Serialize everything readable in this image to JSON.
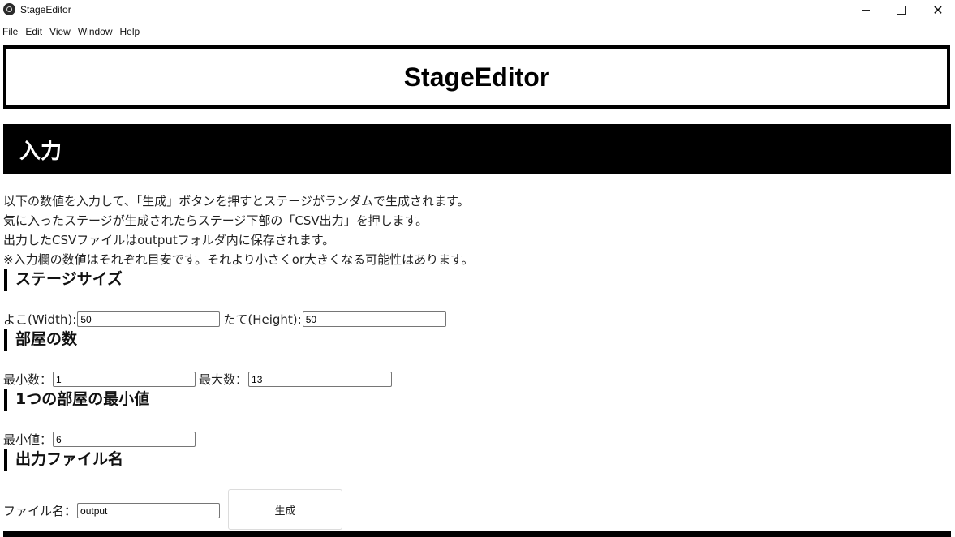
{
  "window": {
    "title": "StageEditor",
    "minimize_glyph": "—",
    "close_glyph": "✕"
  },
  "menu": [
    "File",
    "Edit",
    "View",
    "Window",
    "Help"
  ],
  "header": {
    "title": "StageEditor"
  },
  "section": {
    "title": "入力"
  },
  "description": [
    "以下の数値を入力して、「生成」ボタンを押すとステージがランダムで生成されます。",
    "気に入ったステージが生成されたらステージ下部の「CSV出力」を押します。",
    "出力したCSVファイルはoutputフォルダ内に保存されます。",
    "※入力欄の数値はそれぞれ目安です。それより小さくor大きくなる可能性はあります。"
  ],
  "stage_size": {
    "heading": "ステージサイズ",
    "width_label": "よこ(Width):",
    "width_value": "50",
    "height_label": "たて(Height):",
    "height_value": "50"
  },
  "room_count": {
    "heading": "部屋の数",
    "min_label": "最小数：",
    "min_value": "1",
    "max_label": "最大数：",
    "max_value": "13"
  },
  "room_min": {
    "heading": "1つの部屋の最小値",
    "min_label": "最小値：",
    "min_value": "6"
  },
  "output_file": {
    "heading": "出力ファイル名",
    "name_label": "ファイル名：",
    "name_value": "output",
    "generate_label": "生成"
  }
}
